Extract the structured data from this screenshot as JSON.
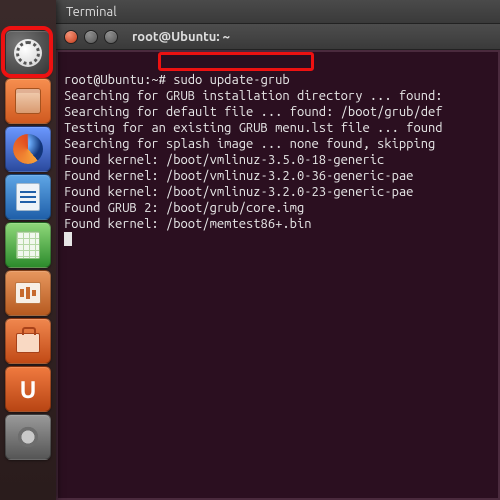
{
  "menubar": {
    "app_label": "Terminal"
  },
  "window": {
    "title": "root@Ubuntu: ~",
    "buttons": {
      "close": "close",
      "min": "minimize",
      "max": "maximize"
    }
  },
  "launcher": {
    "items": [
      {
        "name": "dash-home",
        "label": "Dash Home"
      },
      {
        "name": "files",
        "label": "Files"
      },
      {
        "name": "firefox",
        "label": "Firefox"
      },
      {
        "name": "libreoffice-writer",
        "label": "LibreOffice Writer"
      },
      {
        "name": "libreoffice-calc",
        "label": "LibreOffice Calc"
      },
      {
        "name": "libreoffice-impress",
        "label": "LibreOffice Impress"
      },
      {
        "name": "software-center",
        "label": "Ubuntu Software Center"
      },
      {
        "name": "ubuntu-one",
        "label": "Ubuntu One"
      },
      {
        "name": "system-settings",
        "label": "System Settings"
      }
    ]
  },
  "terminal": {
    "prompt_user_host": "root@Ubuntu",
    "prompt_path": "~",
    "prompt_suffix": "#",
    "command": "sudo update-grub",
    "lines": [
      "Searching for GRUB installation directory ... found:",
      "Searching for default file ... found: /boot/grub/def",
      "Testing for an existing GRUB menu.lst file ... found",
      "Searching for splash image ... none found, skipping ",
      "Found kernel: /boot/vmlinuz-3.5.0-18-generic",
      "Found kernel: /boot/vmlinuz-3.2.0-36-generic-pae",
      "Found kernel: /boot/vmlinuz-3.2.0-23-generic-pae",
      "Found GRUB 2: /boot/grub/core.img",
      "Found kernel: /boot/memtest86+.bin"
    ]
  },
  "highlights": {
    "dash": true,
    "command": true
  }
}
